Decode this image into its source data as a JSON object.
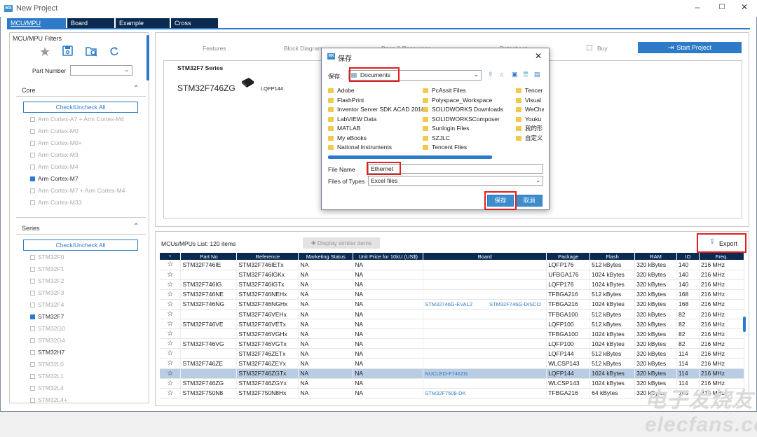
{
  "window": {
    "logo": "MX",
    "title": "New Project",
    "minimize": "–",
    "maximize": "☐",
    "close": "✕"
  },
  "tabs": [
    "MCU/MPU Selector",
    "Board Selector",
    "Example Selector",
    "Cross Selector"
  ],
  "filters": {
    "title": "MCU/MPU Filters",
    "part_number_label": "Part Number",
    "core_label": "Core",
    "check_uncheck": "Check/Uncheck All",
    "core_items": [
      {
        "label": "Arm Cortex-A7 + Arm Cortex-M4",
        "checked": false
      },
      {
        "label": "Arm Cortex-M0",
        "checked": false
      },
      {
        "label": "Arm Cortex-M0+",
        "checked": false
      },
      {
        "label": "Arm Cortex-M3",
        "checked": false
      },
      {
        "label": "Arm Cortex-M4",
        "checked": false
      },
      {
        "label": "Arm Cortex-M7",
        "checked": true
      },
      {
        "label": "Arm Cortex-M7 + Arm Cortex-M4",
        "checked": false
      },
      {
        "label": "Arm Cortex-M33",
        "checked": false
      }
    ],
    "series_label": "Series",
    "series_items": [
      {
        "label": "STM32F0",
        "checked": false,
        "enabled": false
      },
      {
        "label": "STM32F1",
        "checked": false,
        "enabled": false
      },
      {
        "label": "STM32F2",
        "checked": false,
        "enabled": false
      },
      {
        "label": "STM32F3",
        "checked": false,
        "enabled": false
      },
      {
        "label": "STM32F4",
        "checked": false,
        "enabled": false
      },
      {
        "label": "STM32F7",
        "checked": true,
        "enabled": true
      },
      {
        "label": "STM32G0",
        "checked": false,
        "enabled": false
      },
      {
        "label": "STM32G4",
        "checked": false,
        "enabled": false
      },
      {
        "label": "STM32H7",
        "checked": false,
        "enabled": true
      },
      {
        "label": "STM32L0",
        "checked": false,
        "enabled": false
      },
      {
        "label": "STM32L1",
        "checked": false,
        "enabled": false
      },
      {
        "label": "STM32L4",
        "checked": false,
        "enabled": false
      },
      {
        "label": "STM32L4+",
        "checked": false,
        "enabled": false
      }
    ]
  },
  "top_menu": {
    "features": "Features",
    "block_diagram": "Block Diagram",
    "docs": "Docs & Resources",
    "datasheet": "Datasheet",
    "buy": "Buy",
    "start_project": "Start Project"
  },
  "series_box": {
    "series": "STM32F7 Series",
    "part": "STM32F746ZG",
    "package": "LQFP144"
  },
  "list": {
    "count_label": "MCUs/MPUs List: 120 items",
    "display_similar": "Display similar items",
    "export": "Export",
    "headers": [
      "*",
      "Part No",
      "Reference",
      "Marketing Status",
      "Unit Price for 10kU (US$)",
      "Board",
      "Package",
      "Flash",
      "RAM",
      "IO",
      "Freq."
    ],
    "rows": [
      {
        "part": "STM32F746IE",
        "ref": "STM32F746IETx",
        "status": "NA",
        "price": "NA",
        "board1": "",
        "board2": "",
        "pkg": "LQFP176",
        "flash": "512 kBytes",
        "ram": "320 kBytes",
        "io": "140",
        "freq": "216 MHz"
      },
      {
        "part": "",
        "ref": "STM32F746IGKx",
        "status": "NA",
        "price": "NA",
        "board1": "",
        "board2": "",
        "pkg": "UFBGA176",
        "flash": "1024 kBytes",
        "ram": "320 kBytes",
        "io": "140",
        "freq": "216 MHz"
      },
      {
        "part": "STM32F746IG",
        "ref": "STM32F746IGTx",
        "status": "NA",
        "price": "NA",
        "board1": "",
        "board2": "",
        "pkg": "LQFP176",
        "flash": "1024 kBytes",
        "ram": "320 kBytes",
        "io": "140",
        "freq": "216 MHz"
      },
      {
        "part": "STM32F746NE",
        "ref": "STM32F746NEHx",
        "status": "NA",
        "price": "NA",
        "board1": "",
        "board2": "",
        "pkg": "TFBGA216",
        "flash": "512 kBytes",
        "ram": "320 kBytes",
        "io": "168",
        "freq": "216 MHz"
      },
      {
        "part": "STM32F746NG",
        "ref": "STM32F746NGHx",
        "status": "NA",
        "price": "NA",
        "board1": "STM32746G-EVAL2",
        "board2": "STM32F746G-DISCO",
        "pkg": "TFBGA216",
        "flash": "1024 kBytes",
        "ram": "320 kBytes",
        "io": "168",
        "freq": "216 MHz"
      },
      {
        "part": "",
        "ref": "STM32F746VEHx",
        "status": "NA",
        "price": "NA",
        "board1": "",
        "board2": "",
        "pkg": "TFBGA100",
        "flash": "512 kBytes",
        "ram": "320 kBytes",
        "io": "82",
        "freq": "216 MHz"
      },
      {
        "part": "STM32F746VE",
        "ref": "STM32F746VETx",
        "status": "NA",
        "price": "NA",
        "board1": "",
        "board2": "",
        "pkg": "LQFP100",
        "flash": "512 kBytes",
        "ram": "320 kBytes",
        "io": "82",
        "freq": "216 MHz"
      },
      {
        "part": "",
        "ref": "STM32F746VGHx",
        "status": "NA",
        "price": "NA",
        "board1": "",
        "board2": "",
        "pkg": "TFBGA100",
        "flash": "1024 kBytes",
        "ram": "320 kBytes",
        "io": "82",
        "freq": "216 MHz"
      },
      {
        "part": "STM32F746VG",
        "ref": "STM32F746VGTx",
        "status": "NA",
        "price": "NA",
        "board1": "",
        "board2": "",
        "pkg": "LQFP100",
        "flash": "1024 kBytes",
        "ram": "320 kBytes",
        "io": "82",
        "freq": "216 MHz"
      },
      {
        "part": "",
        "ref": "STM32F746ZETx",
        "status": "NA",
        "price": "NA",
        "board1": "",
        "board2": "",
        "pkg": "LQFP144",
        "flash": "512 kBytes",
        "ram": "320 kBytes",
        "io": "114",
        "freq": "216 MHz"
      },
      {
        "part": "STM32F746ZE",
        "ref": "STM32F746ZEYx",
        "status": "NA",
        "price": "NA",
        "board1": "",
        "board2": "",
        "pkg": "WLCSP143",
        "flash": "512 kBytes",
        "ram": "320 kBytes",
        "io": "114",
        "freq": "216 MHz"
      },
      {
        "part": "",
        "ref": "STM32F746ZGTx",
        "status": "NA",
        "price": "NA",
        "board1": "NUCLEO-F746ZG",
        "board2": "",
        "pkg": "LQFP144",
        "flash": "1024 kBytes",
        "ram": "320 kBytes",
        "io": "114",
        "freq": "216 MHz",
        "selected": true
      },
      {
        "part": "STM32F746ZG",
        "ref": "STM32F746ZGYx",
        "status": "NA",
        "price": "NA",
        "board1": "",
        "board2": "",
        "pkg": "WLCSP143",
        "flash": "1024 kBytes",
        "ram": "320 kBytes",
        "io": "114",
        "freq": "216 MHz"
      },
      {
        "part": "STM32F750N8",
        "ref": "STM32F750N8Hx",
        "status": "NA",
        "price": "NA",
        "board1": "STM32F7508-DK",
        "board2": "",
        "pkg": "TFBGA216",
        "flash": "64 kBytes",
        "ram": "320 kBytes",
        "io": "168",
        "freq": "216 MHz"
      }
    ]
  },
  "save_dialog": {
    "title": "保存",
    "close": "✕",
    "location_label": "保存:",
    "location": "Documents",
    "folders_col1": [
      "Adobe",
      "FlashPrint",
      "Inventor Server SDK ACAD 2018",
      "LabVIEW Data",
      "MATLAB",
      "My eBooks",
      "National Instruments"
    ],
    "folders_col2": [
      "PcAssit Files",
      "Polyspace_Workspace",
      "SOLIDWORKS Downloads",
      "SOLIDWORKSComposer",
      "Sunlogin Files",
      "SZJLC",
      "Tencent Files"
    ],
    "folders_col3": [
      "Tencer",
      "Visual",
      "WeCha",
      "Youku",
      "我的形",
      "自定义"
    ],
    "file_name_label": "File Name",
    "file_name": "Ethernet",
    "files_of_type_label": "Files of Types",
    "files_of_type": "Excel files",
    "save_btn": "保存",
    "cancel_btn": "取消"
  },
  "watermark": "电子发烧友 elecfans.com"
}
